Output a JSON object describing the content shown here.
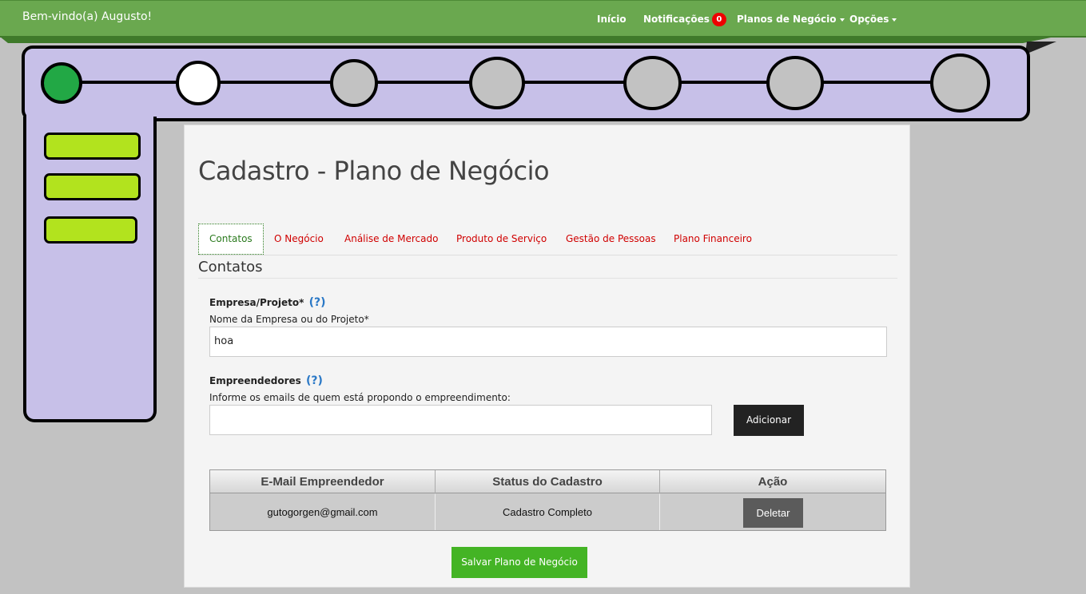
{
  "navbar": {
    "welcome": "Bem-vindo(a) Augusto!",
    "links": {
      "home": "Início",
      "notifications": "Notificações",
      "notifications_count": "0",
      "plans": "Planos de Negócio",
      "options": "Opções"
    }
  },
  "stepper": {
    "steps_total": 7,
    "completed_steps": 1,
    "current_step": 2,
    "sidebar_items": 3,
    "colors": {
      "panel": "#c7c0e8",
      "done": "#22a845",
      "current": "#ffffff",
      "pending": "#c2c2c2",
      "sidebar_item": "#b2e31e"
    }
  },
  "page": {
    "title": "Cadastro - Plano de Negócio",
    "tabs": [
      "Contatos",
      "O Negócio",
      "Análise de Mercado",
      "Produto de Serviço",
      "Gestão de Pessoas",
      "Plano Financeiro"
    ],
    "active_tab": "Contatos",
    "section_title": "Contatos"
  },
  "form": {
    "company": {
      "label": "Empresa/Projeto*",
      "help": "(?)",
      "hint": "Nome da Empresa ou do Projeto*",
      "value": "hoa"
    },
    "entrepreneurs": {
      "label": "Empreendedores",
      "help": "(?)",
      "hint": "Informe os emails de quem está propondo o empreendimento:",
      "value": "",
      "add_button": "Adicionar"
    }
  },
  "table": {
    "headers": [
      "E-Mail Empreendedor",
      "Status do Cadastro",
      "Ação"
    ],
    "rows": [
      {
        "email": "gutogorgen@gmail.com",
        "status": "Cadastro Completo",
        "action": "Deletar"
      }
    ]
  },
  "save_button": "Salvar Plano de Negócio",
  "colors": {
    "navbar": "#6aa84f",
    "tab_active": "#2b7a1e",
    "tab_inactive": "#d00000",
    "save": "#44b425",
    "badge": "#ee0000"
  }
}
